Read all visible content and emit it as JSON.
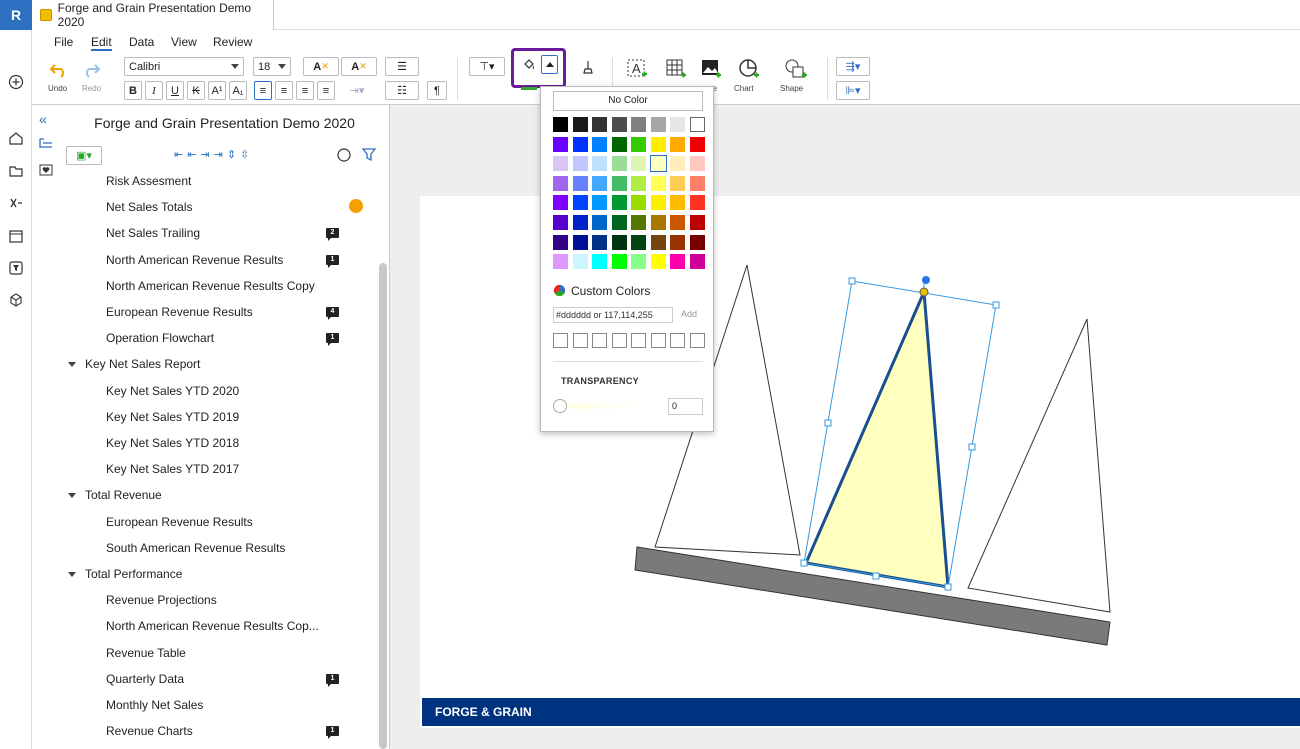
{
  "app": {
    "logo": "R",
    "doc_tab": "Forge and Grain Presentation Demo 2020"
  },
  "menu": [
    "File",
    "Edit",
    "Data",
    "View",
    "Review"
  ],
  "toolbar": {
    "undo": "Undo",
    "redo": "Redo",
    "font_name": "Calibri",
    "font_size": "18",
    "chart": "Chart",
    "shape": "Shape",
    "image_partial": "ge"
  },
  "panel": {
    "title": "Forge and Grain Presentation Demo 2020",
    "items": [
      {
        "label": "Risk Assesment",
        "level": 2
      },
      {
        "label": "Net Sales Totals",
        "level": 2,
        "dot": true
      },
      {
        "label": "Net Sales Trailing",
        "level": 2,
        "badge": "2"
      },
      {
        "label": "North American Revenue Results",
        "level": 2,
        "badge": "1"
      },
      {
        "label": "North American Revenue Results Copy",
        "level": 2
      },
      {
        "label": "European Revenue Results",
        "level": 2,
        "badge": "4"
      },
      {
        "label": "Operation Flowchart",
        "level": 2,
        "badge": "1"
      },
      {
        "label": "Key Net Sales Report",
        "level": 1
      },
      {
        "label": "Key Net Sales YTD 2020",
        "level": 2
      },
      {
        "label": "Key Net Sales YTD 2019",
        "level": 2
      },
      {
        "label": "Key Net Sales YTD 2018",
        "level": 2
      },
      {
        "label": "Key Net Sales YTD 2017",
        "level": 2
      },
      {
        "label": "Total Revenue",
        "level": 1
      },
      {
        "label": "European Revenue Results",
        "level": 2
      },
      {
        "label": "South American Revenue Results",
        "level": 2
      },
      {
        "label": "Total Performance",
        "level": 1
      },
      {
        "label": "Revenue Projections",
        "level": 2
      },
      {
        "label": "North American Revenue Results Cop...",
        "level": 2
      },
      {
        "label": "Revenue Table",
        "level": 2
      },
      {
        "label": "Quarterly Data",
        "level": 2,
        "badge": "1"
      },
      {
        "label": "Monthly Net Sales",
        "level": 2
      },
      {
        "label": "Revenue Charts",
        "level": 2,
        "badge": "1"
      }
    ]
  },
  "color_popup": {
    "no_color": "No Color",
    "custom_colors": "Custom Colors",
    "hex_placeholder": "#dddddd or 117,114,255",
    "add": "Add",
    "transparency": "TRANSPARENCY",
    "transparency_value": "0",
    "palette": [
      [
        "#000000",
        "#1a1a1a",
        "#333333",
        "#4d4d4d",
        "#808080",
        "#a6a6a6",
        "#e6e6e6",
        "#ffffff"
      ],
      [
        "#6a00ff",
        "#0033ff",
        "#0080ff",
        "#006600",
        "#33cc00",
        "#ffee00",
        "#ffaa00",
        "#ee0000"
      ],
      [
        "#d9c6f5",
        "#c0c6ff",
        "#c0e0ff",
        "#99dd99",
        "#ddf5b0",
        "#ffffc0",
        "#ffeebb",
        "#ffc8c0"
      ],
      [
        "#a066ee",
        "#6680ff",
        "#44aaff",
        "#44bb66",
        "#b0ee44",
        "#ffff55",
        "#ffcc55",
        "#ff8066"
      ],
      [
        "#8000ff",
        "#0044ff",
        "#0099ff",
        "#009933",
        "#99dd00",
        "#ffee00",
        "#ffbb00",
        "#ff3322"
      ],
      [
        "#5500cc",
        "#0022cc",
        "#0066cc",
        "#006622",
        "#557700",
        "#aa7700",
        "#cc5500",
        "#bb0000"
      ],
      [
        "#330088",
        "#001199",
        "#003388",
        "#003311",
        "#004411",
        "#774411",
        "#993300",
        "#770000"
      ],
      [
        "#dd99ff",
        "#ccf5ff",
        "#00ffff",
        "#00ff00",
        "#88ff88",
        "#ffff00",
        "#ff00aa",
        "#cc0099"
      ]
    ],
    "selected_swatch": "#ffffc0"
  },
  "slide": {
    "footer": "FORGE & GRAIN"
  },
  "colors": {
    "accent": "#2d6fc1",
    "highlight": "#6a1b9a",
    "footer": "#00337f",
    "fill": "#ffffc0",
    "selection": "#3399dd"
  }
}
